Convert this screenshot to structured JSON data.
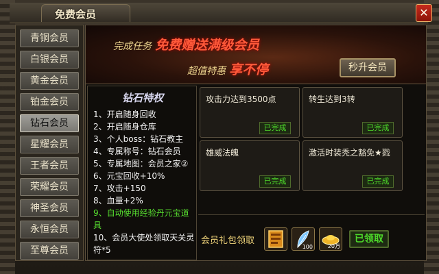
{
  "window": {
    "title": "免费会员",
    "close_label": "✕"
  },
  "sidebar": {
    "items": [
      {
        "label": "青铜会员"
      },
      {
        "label": "白银会员"
      },
      {
        "label": "黄金会员"
      },
      {
        "label": "铂金会员"
      },
      {
        "label": "钻石会员"
      },
      {
        "label": "星耀会员"
      },
      {
        "label": "王者会员"
      },
      {
        "label": "荣耀会员"
      },
      {
        "label": "神圣会员"
      },
      {
        "label": "永恒会员"
      },
      {
        "label": "至尊会员"
      }
    ],
    "active_index": 4
  },
  "banner": {
    "line1_small": "完成任务",
    "line1_big": "免费赠送满级会员",
    "line2_small": "超值特惠",
    "line2_big": "享不停",
    "button_label": "秒升会员"
  },
  "privileges": {
    "title": "钻石特权",
    "items": [
      "1、开启随身回收",
      "2、开启随身仓库",
      "3、个人boss：钻石教主",
      "4、专属称号：钻石会员",
      "5、专属地图：会员之家②",
      "6、元宝回收+10%",
      "7、攻击+150",
      "8、血量+2%",
      "9、自动使用经验丹元宝道具",
      "10、会员大使处领取天关灵符*5"
    ],
    "highlight_index": 8
  },
  "tasks": [
    {
      "text": "攻击力达到3500点",
      "status": "已完成"
    },
    {
      "text": "转生达到3转",
      "status": "已完成"
    },
    {
      "text": "雄威法魄",
      "status": "已完成"
    },
    {
      "text": "激活时装秃之豁免★戮",
      "status": "已完成"
    }
  ],
  "gift": {
    "label": "会员礼包领取",
    "items": [
      {
        "icon": "scroll-icon",
        "qty": ""
      },
      {
        "icon": "feather-icon",
        "qty": "100"
      },
      {
        "icon": "gold-ingot-icon",
        "qty": "20万"
      }
    ],
    "button_label": "已领取"
  },
  "colors": {
    "accent_red": "#ff5a3a",
    "done_green": "#4dd82a",
    "gold_text": "#f0d47a"
  }
}
